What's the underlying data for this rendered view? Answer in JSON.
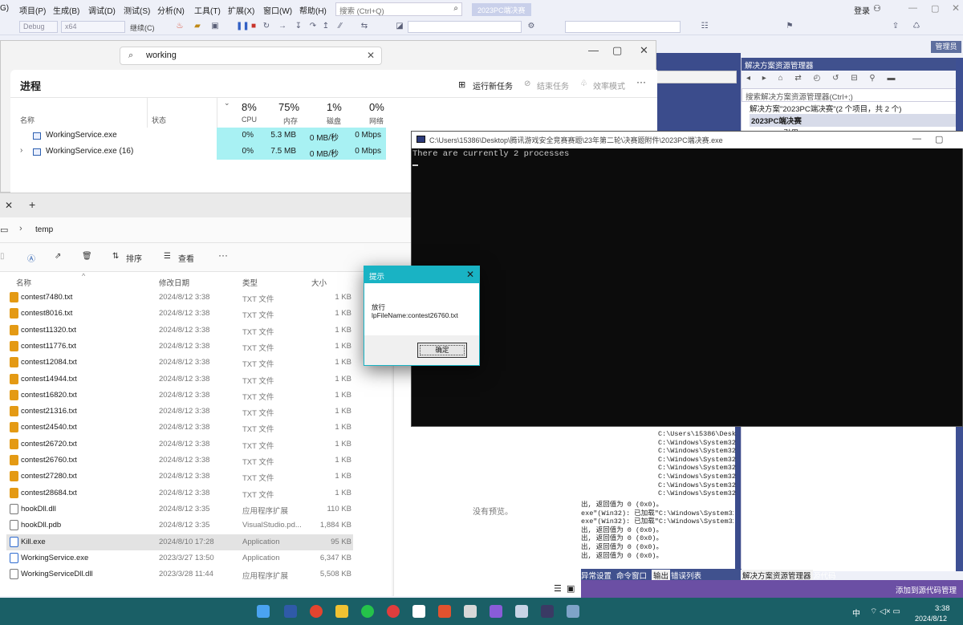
{
  "vs": {
    "menu": [
      "G)",
      "项目(P)",
      "生成(B)",
      "调试(D)",
      "测试(S)",
      "分析(N)",
      "工具(T)",
      "扩展(X)",
      "窗口(W)",
      "帮助(H)"
    ],
    "search_placeholder": "搜索 (Ctrl+Q)",
    "solution_name": "2023PC端决赛",
    "signin": "登录",
    "config": "Debug",
    "platform": "x64",
    "continue": "继续(C)",
    "admin_badge": "管理员",
    "solution_explorer_title": "解决方案资源管理器",
    "se_search_placeholder": "搜索解决方案资源管理器(Ctrl+;)",
    "se_solution_line": "解决方案\"2023PC端决赛\"(2 个项目，共 2 个)",
    "se_project": "2023PC端决赛",
    "se_subitem": "引用",
    "output_lines": [
      "C:\\Users\\15386\\Desk",
      "C:\\Windows\\System32",
      "C:\\Windows\\System32",
      "C:\\Windows\\System32",
      "C:\\Windows\\System32",
      "C:\\Windows\\System32",
      "C:\\Windows\\System32",
      "C:\\Windows\\System32",
      "出, 返回值为 0 (0x0)。",
      "exe\"(Win32): 已加载\"C:\\Windows\\System32",
      "exe\"(Win32): 已加载\"C:\\Windows\\System32",
      "出, 返回值为 0 (0x0)。",
      "出, 返回值为 0 (0x0)。",
      "出, 返回值为 0 (0x0)。",
      "出, 返回值为 0 (0x0)。"
    ],
    "output_tabs": [
      "异常设置",
      "命令窗口",
      "输出",
      "错误列表"
    ],
    "se_tabs": [
      "解决方案资源管理器",
      "源代码"
    ],
    "add_source_control": "添加到源代码管理"
  },
  "taskmgr": {
    "search_value": "working",
    "title": "进程",
    "run_task": "运行新任务",
    "end_task": "结束任务",
    "efficiency": "效率模式",
    "col_name": "名称",
    "col_status": "状态",
    "cpu_pct": "8%",
    "cpu_label": "CPU",
    "mem_pct": "75%",
    "mem_label": "内存",
    "disk_pct": "1%",
    "disk_label": "磁盘",
    "net_pct": "0%",
    "net_label": "网络",
    "rows": [
      {
        "name": "WorkingService.exe",
        "cpu": "0%",
        "mem": "5.3 MB",
        "disk": "0 MB/秒",
        "net": "0 Mbps"
      },
      {
        "name": "WorkingService.exe (16)",
        "cpu": "0%",
        "mem": "7.5 MB",
        "disk": "0 MB/秒",
        "net": "0 Mbps"
      }
    ]
  },
  "explorer": {
    "path": "temp",
    "sort_label": "排序",
    "view_label": "查看",
    "more": "···",
    "col_name": "名称",
    "col_date": "修改日期",
    "col_type": "类型",
    "col_size": "大小",
    "files": [
      {
        "name": "contest7480.txt",
        "date": "2024/8/12 3:38",
        "type": "TXT 文件",
        "size": "1 KB",
        "kind": "txt"
      },
      {
        "name": "contest8016.txt",
        "date": "2024/8/12 3:38",
        "type": "TXT 文件",
        "size": "1 KB",
        "kind": "txt"
      },
      {
        "name": "contest11320.txt",
        "date": "2024/8/12 3:38",
        "type": "TXT 文件",
        "size": "1 KB",
        "kind": "txt"
      },
      {
        "name": "contest11776.txt",
        "date": "2024/8/12 3:38",
        "type": "TXT 文件",
        "size": "1 KB",
        "kind": "txt"
      },
      {
        "name": "contest12084.txt",
        "date": "2024/8/12 3:38",
        "type": "TXT 文件",
        "size": "1 KB",
        "kind": "txt"
      },
      {
        "name": "contest14944.txt",
        "date": "2024/8/12 3:38",
        "type": "TXT 文件",
        "size": "1 KB",
        "kind": "txt"
      },
      {
        "name": "contest16820.txt",
        "date": "2024/8/12 3:38",
        "type": "TXT 文件",
        "size": "1 KB",
        "kind": "txt"
      },
      {
        "name": "contest21316.txt",
        "date": "2024/8/12 3:38",
        "type": "TXT 文件",
        "size": "1 KB",
        "kind": "txt"
      },
      {
        "name": "contest24540.txt",
        "date": "2024/8/12 3:38",
        "type": "TXT 文件",
        "size": "1 KB",
        "kind": "txt"
      },
      {
        "name": "contest26720.txt",
        "date": "2024/8/12 3:38",
        "type": "TXT 文件",
        "size": "1 KB",
        "kind": "txt"
      },
      {
        "name": "contest26760.txt",
        "date": "2024/8/12 3:38",
        "type": "TXT 文件",
        "size": "1 KB",
        "kind": "txt"
      },
      {
        "name": "contest27280.txt",
        "date": "2024/8/12 3:38",
        "type": "TXT 文件",
        "size": "1 KB",
        "kind": "txt"
      },
      {
        "name": "contest28684.txt",
        "date": "2024/8/12 3:38",
        "type": "TXT 文件",
        "size": "1 KB",
        "kind": "txt"
      },
      {
        "name": "hookDll.dll",
        "date": "2024/8/12 3:35",
        "type": "应用程序扩展",
        "size": "110 KB",
        "kind": "dll"
      },
      {
        "name": "hookDll.pdb",
        "date": "2024/8/12 3:35",
        "type": "VisualStudio.pd...",
        "size": "1,884 KB",
        "kind": "dll"
      },
      {
        "name": "Kill.exe",
        "date": "2024/8/10 17:28",
        "type": "Application",
        "size": "95 KB",
        "kind": "exe"
      },
      {
        "name": "WorkingService.exe",
        "date": "2023/3/27 13:50",
        "type": "Application",
        "size": "6,347 KB",
        "kind": "exe"
      },
      {
        "name": "WorkingServiceDll.dll",
        "date": "2023/3/28 11:44",
        "type": "应用程序扩展",
        "size": "5,508 KB",
        "kind": "dll"
      }
    ],
    "preview_text": "没有预览。"
  },
  "console": {
    "title": "C:\\Users\\15386\\Desktop\\腾讯游戏安全竞赛赛题\\23年第二轮\\决赛题附件\\2023PC端决赛.exe",
    "output": "There are currently 2 processes"
  },
  "msgbox": {
    "title": "提示",
    "line1": "放行",
    "line2": "lpFileName:contest26760.txt",
    "ok": "确定"
  },
  "taskbar": {
    "ime": "中",
    "time": "3:38",
    "date": "2024/8/12"
  },
  "colors": {
    "accent_cyan": "#19b3c4",
    "vs_navy": "#40518e",
    "taskbar": "#1a5f66",
    "highlight_cell": "#a8f1f3"
  }
}
